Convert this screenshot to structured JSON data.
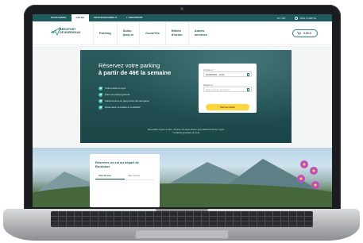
{
  "topbar": {
    "tabs": [
      "PASSAGERS",
      "OFFRE",
      "PROFESSIONNELS",
      "L'AEROPORT"
    ],
    "lang": "FR / EN",
    "account": "MON COMPTE"
  },
  "logo": {
    "text": "AEROPORT\nDE BORDEAUX"
  },
  "nav": {
    "items": [
      "Parking",
      "Salon\n(bar)-le",
      "Covoi'ille",
      "Billets\nd'avion",
      "Autres\nservices"
    ],
    "cart_total": "0,00 €"
  },
  "hero": {
    "title_line1": "Réservez votre parking",
    "title_line2": "à partir de 46€ la semaine",
    "features": [
      "Tarifs réduits en ligne",
      "Place de parking garantie",
      "Stationnement au plus proche des aérogares",
      "Réservation annulable et modifiable*"
    ],
    "note_line1": "Réservation 6 jours ou plus - 30 jours min avant arrivée, pour stationnement de 7 jours",
    "note_line2": "* conditions générales de vente"
  },
  "booking": {
    "arrival_label": "Arrivée le *",
    "arrival_value": "20/08/2025 - 12:00",
    "departure_label": "Départ le *",
    "departure_placeholder": "Date et heure de départ",
    "submit": "Voir les tarifs"
  },
  "flight": {
    "title": "Réserver un vol au départ de Bordeaux",
    "tabs": [
      "Aller-Retour",
      "Aller Simple"
    ]
  },
  "colors": {
    "brand": "#1f5a5c",
    "hero_bg": "#1e5154",
    "accent_button": "#ffd53a",
    "check": "#3dbcaa"
  }
}
